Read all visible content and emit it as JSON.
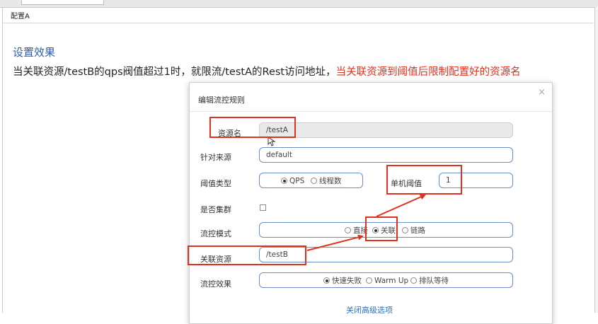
{
  "document": {
    "tab_title": "配置A",
    "heading": "设置效果",
    "description_plain": "当关联资源/testB的qps阀值超过1时，就限流/testA的Rest访问地址，",
    "description_emphasis": "当关联资源到阈值后限制配置好的资源名"
  },
  "dialog": {
    "title": "编辑流控规则",
    "close_symbol": "×",
    "resource_name_label": "资源名",
    "resource_name_value": "/testA",
    "limit_app_label": "针对来源",
    "limit_app_value": "default",
    "threshold_type_label": "阈值类型",
    "threshold_type_options": [
      "QPS",
      "线程数"
    ],
    "threshold_type_selected": "QPS",
    "single_threshold_label": "单机阈值",
    "single_threshold_value": "1",
    "cluster_label": "是否集群",
    "cluster_checked": false,
    "strategy_label": "流控模式",
    "strategy_options": [
      "直接",
      "关联",
      "链路"
    ],
    "strategy_selected": "关联",
    "ref_resource_label": "关联资源",
    "ref_resource_value": "/testB",
    "control_effect_label": "流控效果",
    "control_effect_options": [
      "快速失败",
      "Warm Up",
      "排队等待"
    ],
    "control_effect_selected": "快速失败",
    "advanced_toggle": "关闭高级选项"
  },
  "annotation_color": "#e0301e"
}
